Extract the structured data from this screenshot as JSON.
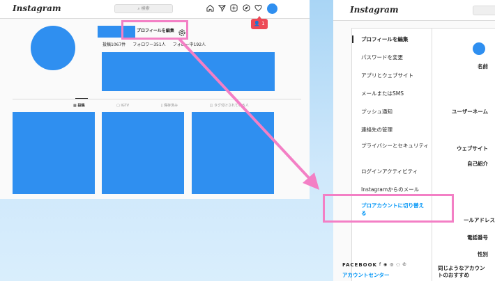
{
  "left_screen": {
    "logo": "Instagram",
    "search_placeholder": "検索",
    "notification_count": "1",
    "edit_profile_label": "プロフィールを編集",
    "stats": {
      "posts": "投稿1067件",
      "followers": "フォロワー351人",
      "following": "フォロー中192人"
    },
    "tabs": [
      "投稿",
      "IGTV",
      "保存済み",
      "タグ付けされている人"
    ],
    "accent_color": "#2f8ff0",
    "highlight_color": "#f37fc5"
  },
  "right_screen": {
    "logo": "Instagram",
    "menu_items": [
      "プロフィールを編集",
      "パスワードを変更",
      "アプリとウェブサイト",
      "メールまたはSMS",
      "プッシュ通知",
      "連絡先の管理",
      "プライバシーとセキュリティ",
      "ログインアクティビティ",
      "Instagramからのメール",
      "プロアカウントに切り替える"
    ],
    "facebook_label": "FACEBOOK",
    "facebook_icons": "f ◉ ◎ ◌ ✆",
    "account_center": "アカウントセンター",
    "form_labels": {
      "name": "名前",
      "username": "ユーザーネーム",
      "website": "ウェブサイト",
      "bio": "自己紹介",
      "email": "ールアドレス",
      "phone": "電話番号",
      "gender": "性別",
      "similar_accounts": "同じようなアカウントのおすすめ"
    },
    "link_color": "#0095f6"
  }
}
